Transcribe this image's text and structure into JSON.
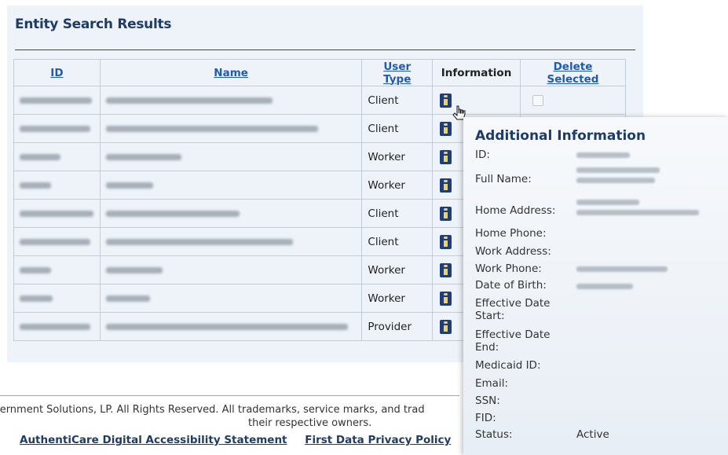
{
  "panel": {
    "title": "Entity Search Results"
  },
  "table": {
    "headers": {
      "id": "ID",
      "name": "Name",
      "user_type": "User Type",
      "information": "Information",
      "delete_selected": "Delete Selected"
    },
    "rows": [
      {
        "user_type": "Client"
      },
      {
        "user_type": "Client"
      },
      {
        "user_type": "Worker"
      },
      {
        "user_type": "Worker"
      },
      {
        "user_type": "Client"
      },
      {
        "user_type": "Client"
      },
      {
        "user_type": "Worker"
      },
      {
        "user_type": "Worker"
      },
      {
        "user_type": "Provider"
      }
    ]
  },
  "popup": {
    "title": "Additional Information",
    "labels": {
      "id": "ID:",
      "full_name": "Full Name:",
      "home_address": "Home Address:",
      "home_phone": "Home Phone:",
      "work_address": "Work Address:",
      "work_phone": "Work Phone:",
      "dob": "Date of Birth:",
      "eff_start": "Effective Date Start:",
      "eff_end": "Effective Date End:",
      "medicaid": "Medicaid ID:",
      "email": "Email:",
      "ssn": "SSN:",
      "fid": "FID:",
      "status": "Status:"
    },
    "status_value": "Active"
  },
  "footer": {
    "copyright_line1": "vernment Solutions, LP. All Rights Reserved. All trademarks, service marks, and trad",
    "copyright_line2": "their respective owners.",
    "link_accessibility": "AuthentiCare Digital Accessibility Statement",
    "link_privacy": "First Data Privacy Policy"
  },
  "icons": {
    "info": "info-icon",
    "cursor": "pointer-cursor-icon",
    "checkbox": "checkbox-icon"
  }
}
